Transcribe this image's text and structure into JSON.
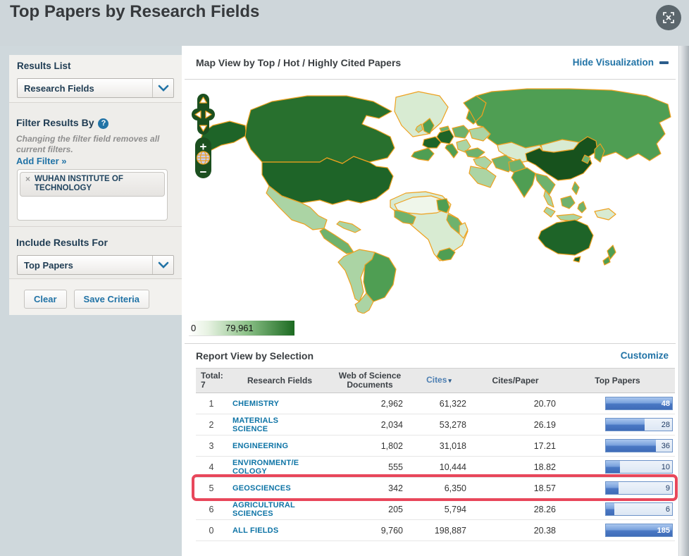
{
  "header": {
    "title": "Top Papers by Research Fields"
  },
  "sidebar": {
    "results_list": {
      "label": "Results List",
      "selected": "Research Fields"
    },
    "filter": {
      "label": "Filter Results By",
      "help": "?",
      "note": "Changing the filter field removes all current filters.",
      "add_filter": "Add Filter »",
      "chips": [
        {
          "remove": "×",
          "label": "WUHAN INSTITUTE OF TECHNOLOGY"
        }
      ]
    },
    "include": {
      "label": "Include Results For",
      "selected": "Top Papers"
    },
    "actions": {
      "clear": "Clear",
      "save": "Save Criteria"
    }
  },
  "visualization": {
    "title": "Map View by Top / Hot / Highly Cited Papers",
    "hide_link": "Hide Visualization",
    "legend": {
      "min": "0",
      "max": "79,961"
    },
    "controls": {
      "zoom_in": "+",
      "zoom_out": "−"
    }
  },
  "report": {
    "title": "Report View by Selection",
    "customize_link": "Customize",
    "table": {
      "total_label": "Total:",
      "total_count": "7",
      "columns": {
        "field": "Research Fields",
        "docs": "Web of Science Documents",
        "cites": "Cites",
        "cites_per_paper": "Cites/Paper",
        "top_papers": "Top Papers"
      },
      "sort": {
        "column": "Cites",
        "indicator": "▾"
      },
      "rows": [
        {
          "rank": "1",
          "field": "CHEMISTRY",
          "docs": "2,962",
          "cites": "61,322",
          "cites_per_paper": "20.70",
          "top_papers": "48",
          "bar_pct": 100,
          "highlighted": false
        },
        {
          "rank": "2",
          "field": "MATERIALS SCIENCE",
          "docs": "2,034",
          "cites": "53,278",
          "cites_per_paper": "26.19",
          "top_papers": "28",
          "bar_pct": 58,
          "highlighted": false
        },
        {
          "rank": "3",
          "field": "ENGINEERING",
          "docs": "1,802",
          "cites": "31,018",
          "cites_per_paper": "17.21",
          "top_papers": "36",
          "bar_pct": 75,
          "highlighted": false
        },
        {
          "rank": "4",
          "field": "ENVIRONMENT/ECOLOGY",
          "docs": "555",
          "cites": "10,444",
          "cites_per_paper": "18.82",
          "top_papers": "10",
          "bar_pct": 21,
          "highlighted": false
        },
        {
          "rank": "5",
          "field": "GEOSCIENCES",
          "docs": "342",
          "cites": "6,350",
          "cites_per_paper": "18.57",
          "top_papers": "9",
          "bar_pct": 19,
          "highlighted": true
        },
        {
          "rank": "6",
          "field": "AGRICULTURAL SCIENCES",
          "docs": "205",
          "cites": "5,794",
          "cites_per_paper": "28.26",
          "top_papers": "6",
          "bar_pct": 13,
          "highlighted": false
        },
        {
          "rank": "0",
          "field": "ALL FIELDS",
          "docs": "9,760",
          "cites": "198,887",
          "cites_per_paper": "20.38",
          "top_papers": "185",
          "bar_pct": 100,
          "highlighted": false
        }
      ]
    }
  },
  "colors": {
    "link_blue": "#2173a6",
    "field_link_blue": "#0e74a6",
    "highlight_red": "#e8475b",
    "map_green_darkest": "#17521d",
    "map_green_dark": "#1e6428",
    "map_green_light": "#abd4a4",
    "bar_blue": "#4a78c4",
    "banner_gray": "#ced6da"
  }
}
